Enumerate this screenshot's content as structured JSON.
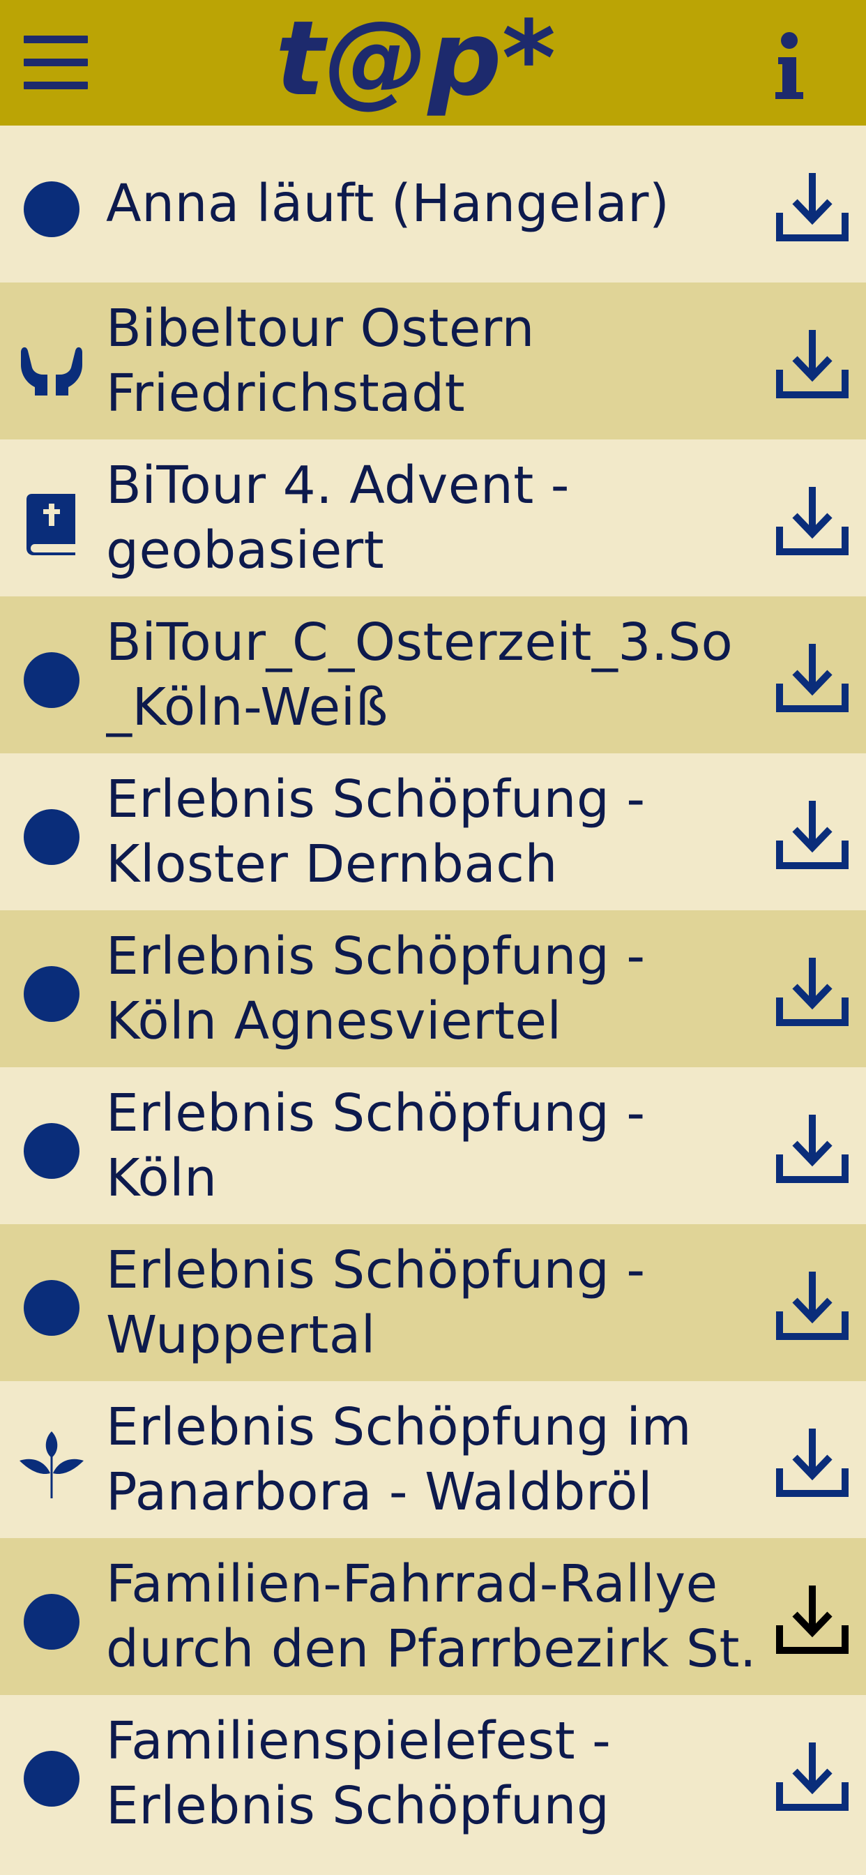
{
  "header": {
    "logo_text": "t@p*",
    "menu_icon": "hamburger-menu-icon",
    "info_icon": "info-icon",
    "background": "#bba405",
    "accent": "#1d2a6d"
  },
  "colors": {
    "row_light": "#f2e9c9",
    "row_dark": "#e0d497",
    "icon_blue": "#0a2d7a",
    "text": "#0d1a4d"
  },
  "tours": [
    {
      "title": "Anna läuft (Hangelar)",
      "icon": "dot-icon",
      "download_icon": "download-icon",
      "download_active": false
    },
    {
      "title": "Bibeltour Ostern\nFriedrichstadt",
      "icon": "praying-hands-icon",
      "download_icon": "download-icon",
      "download_active": false
    },
    {
      "title": "BiTour 4. Advent -\ngeobasiert",
      "icon": "bible-icon",
      "download_icon": "download-icon",
      "download_active": false
    },
    {
      "title": "BiTour_C_Osterzeit_3.So\n_Köln-Weiß",
      "icon": "dot-icon",
      "download_icon": "download-icon",
      "download_active": false
    },
    {
      "title": "Erlebnis Schöpfung -\nKloster Dernbach",
      "icon": "dot-icon",
      "download_icon": "download-icon",
      "download_active": false
    },
    {
      "title": "Erlebnis Schöpfung -\nKöln Agnesviertel",
      "icon": "dot-icon",
      "download_icon": "download-icon",
      "download_active": false
    },
    {
      "title": "Erlebnis Schöpfung -\nKöln",
      "icon": "dot-icon",
      "download_icon": "download-icon",
      "download_active": false
    },
    {
      "title": "Erlebnis Schöpfung -\nWuppertal",
      "icon": "dot-icon",
      "download_icon": "download-icon",
      "download_active": false
    },
    {
      "title": "Erlebnis Schöpfung im\nPanarbora - Waldbröl",
      "icon": "leaf-icon",
      "download_icon": "download-icon",
      "download_active": false
    },
    {
      "title": "Familien-Fahrrad-Rallye\ndurch den Pfarrbezirk St.",
      "icon": "dot-icon",
      "download_icon": "download-icon",
      "download_active": true
    },
    {
      "title": "Familienspielefest -\nErlebnis Schöpfung",
      "icon": "dot-icon",
      "download_icon": "download-icon",
      "download_active": false
    }
  ]
}
